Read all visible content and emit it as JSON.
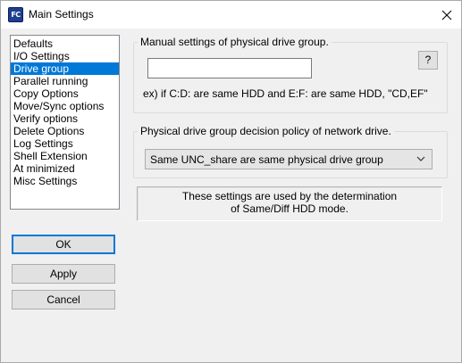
{
  "window": {
    "title": "Main Settings",
    "app_icon_text": "FC"
  },
  "sidebar": {
    "items": [
      {
        "label": "Defaults",
        "selected": false
      },
      {
        "label": "I/O Settings",
        "selected": false
      },
      {
        "label": "Drive group",
        "selected": true
      },
      {
        "label": "Parallel running",
        "selected": false
      },
      {
        "label": "Copy Options",
        "selected": false
      },
      {
        "label": "Move/Sync options",
        "selected": false
      },
      {
        "label": "Verify options",
        "selected": false
      },
      {
        "label": "Delete Options",
        "selected": false
      },
      {
        "label": "Log Settings",
        "selected": false
      },
      {
        "label": "Shell Extension",
        "selected": false
      },
      {
        "label": "At minimized",
        "selected": false
      },
      {
        "label": "Misc Settings",
        "selected": false
      }
    ]
  },
  "buttons": {
    "ok": "OK",
    "apply": "Apply",
    "cancel": "Cancel"
  },
  "manual_group": {
    "label": "Manual settings of physical drive group.",
    "input_value": "",
    "help_label": "?",
    "example": "ex) if C:D: are same HDD and E:F: are same HDD, \"CD,EF\""
  },
  "network_group": {
    "label": "Physical drive group decision policy of network drive.",
    "selected_option": "Same UNC_share are same physical drive group"
  },
  "info": {
    "line1": "These settings are used by the determination",
    "line2": "of Same/Diff HDD mode."
  }
}
